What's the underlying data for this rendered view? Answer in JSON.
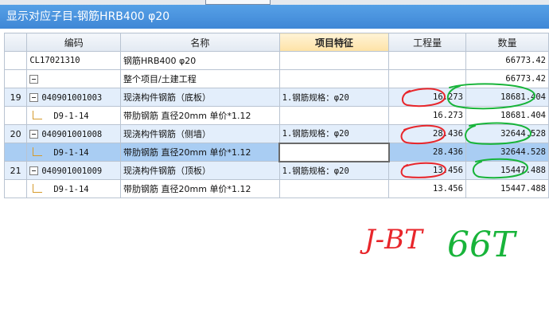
{
  "window": {
    "title": "显示对应子目-钢筋HRB400 φ20"
  },
  "columns": [
    "编码",
    "名称",
    "项目特征",
    "工程量",
    "数量"
  ],
  "rows": [
    {
      "seq": "",
      "code": "CL17021310",
      "name": "钢筋HRB400 φ20",
      "feature": "",
      "qty": "",
      "amount": "66773.42"
    },
    {
      "seq": "",
      "code": "",
      "name": "整个项目/土建工程",
      "feature": "",
      "qty": "",
      "amount": "66773.42"
    },
    {
      "seq": "19",
      "code": "040901001003",
      "name": "现浇构件钢筋（底板）",
      "feature": "1.钢筋规格：φ20",
      "qty": "16.273",
      "amount": "18681.404"
    },
    {
      "seq": "",
      "code": "D9-1-14",
      "name": "带肋钢筋 直径20mm  单价*1.12",
      "feature": "",
      "qty": "16.273",
      "amount": "18681.404"
    },
    {
      "seq": "20",
      "code": "040901001008",
      "name": "现浇构件钢筋（侧墙）",
      "feature": "1.钢筋规格：φ20",
      "qty": "28.436",
      "amount": "32644.528"
    },
    {
      "seq": "",
      "code": "D9-1-14",
      "name": "带肋钢筋 直径20mm  单价*1.12",
      "feature": "",
      "qty": "28.436",
      "amount": "32644.528"
    },
    {
      "seq": "21",
      "code": "040901001009",
      "name": "现浇构件钢筋（顶板）",
      "feature": "1.钢筋规格：φ20",
      "qty": "13.456",
      "amount": "15447.488"
    },
    {
      "seq": "",
      "code": "D9-1-14",
      "name": "带肋钢筋 直径20mm  单价*1.12",
      "feature": "",
      "qty": "13.456",
      "amount": "15447.488"
    }
  ],
  "annotations": {
    "red_note": "J-BT",
    "green_note": "66T"
  },
  "colors": {
    "title_bar": "#4a93e0",
    "selected_row": "#a9cdf3",
    "group_row": "#e3eefb",
    "red_ink": "#e8262b",
    "green_ink": "#18b43a"
  },
  "icons": {
    "collapse": "collapse-minus-icon",
    "tree_line": "tree-branch-icon"
  }
}
